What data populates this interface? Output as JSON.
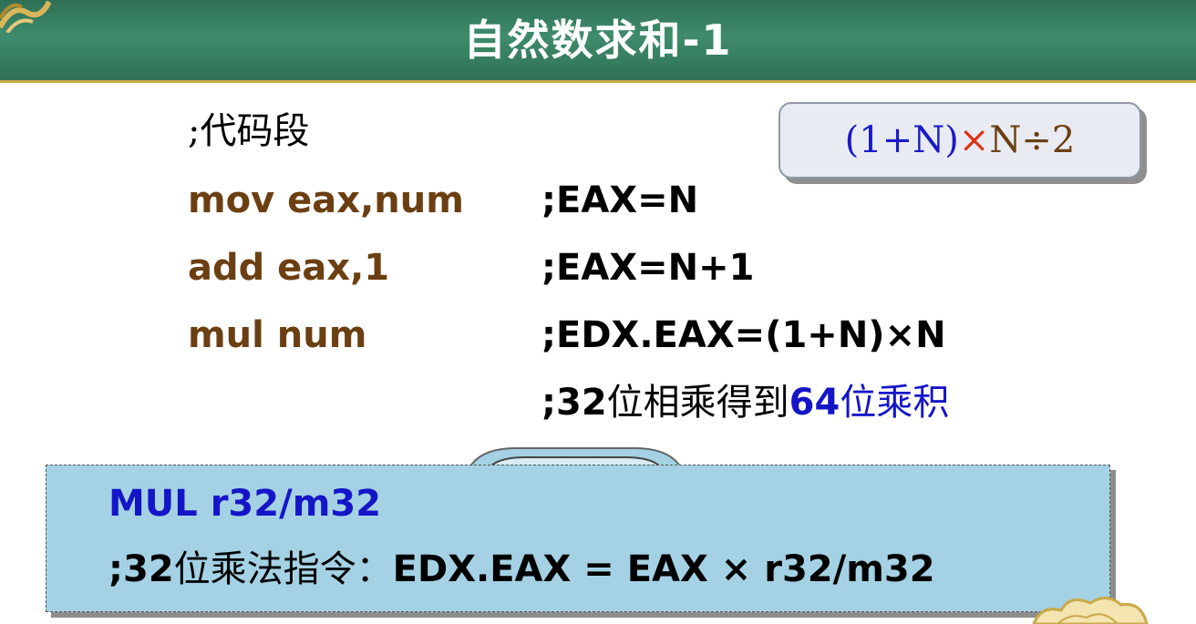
{
  "slide": {
    "title": "自然数求和-1"
  },
  "code": {
    "section_comment": ";代码段",
    "lines": [
      {
        "instr": "mov eax,num",
        "comment": ";EAX=N"
      },
      {
        "instr": "add eax,1",
        "comment": ";EAX=N+1"
      },
      {
        "instr": "mul num",
        "comment": ";EDX.EAX=(1+N)×N"
      }
    ],
    "note": {
      "prefix": ";",
      "num1": "32",
      "text1": "位相乘得到",
      "num2": "64",
      "text2": "位乘积"
    }
  },
  "formula": {
    "part1": "(1+N)",
    "op": "×",
    "part2": "N÷2"
  },
  "info": {
    "instruction": "MUL r32/m32",
    "desc_prefix": ";32",
    "desc_cn": "位乘法指令：",
    "desc_expr": "EDX.EAX = EAX × r32/m32"
  },
  "colors": {
    "header": "#3f8c6c",
    "instruction": "#6b3f12",
    "highlight_blue": "#1515c8",
    "formula_op": "#e03010",
    "info_box": "#a4d2e4"
  },
  "icons": {
    "top_left": "knot-ornament-icon",
    "bottom_right": "cloud-ornament-icon"
  }
}
